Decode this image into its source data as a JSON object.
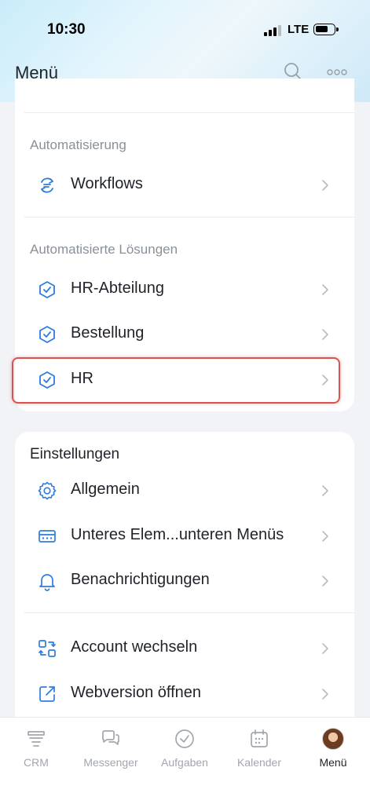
{
  "status_bar": {
    "time": "10:30",
    "network": "LTE"
  },
  "header": {
    "title": "Menü"
  },
  "automation": {
    "label": "Automatisierung",
    "items": [
      {
        "label": "Workflows",
        "icon": "workflow-icon"
      }
    ]
  },
  "solutions": {
    "label": "Automatisierte Lösungen",
    "items": [
      {
        "label": "HR-Abteilung",
        "icon": "shield-check-icon"
      },
      {
        "label": "Bestellung",
        "icon": "shield-check-icon"
      },
      {
        "label": "HR",
        "icon": "shield-check-icon",
        "highlighted": true
      }
    ]
  },
  "settings": {
    "title": "Einstellungen",
    "items": [
      {
        "label": "Allgemein",
        "icon": "gear-icon"
      },
      {
        "label": "Unteres Elem...unteren Menüs",
        "icon": "bottom-menu-icon"
      },
      {
        "label": "Benachrichtigungen",
        "icon": "bell-icon"
      }
    ],
    "account_items": [
      {
        "label": "Account wechseln",
        "icon": "switch-account-icon"
      },
      {
        "label": "Webversion öffnen",
        "icon": "external-link-icon"
      }
    ]
  },
  "tabbar": {
    "tabs": [
      {
        "label": "CRM",
        "icon": "crm-icon"
      },
      {
        "label": "Messenger",
        "icon": "chat-icon"
      },
      {
        "label": "Aufgaben",
        "icon": "check-circle-icon"
      },
      {
        "label": "Kalender",
        "icon": "calendar-icon"
      },
      {
        "label": "Menü",
        "icon": "avatar",
        "active": true
      }
    ]
  },
  "colors": {
    "accent": "#2e7ce0",
    "highlight": "#d9534f",
    "muted_text": "#8a9098",
    "background": "#f1f3f6"
  }
}
